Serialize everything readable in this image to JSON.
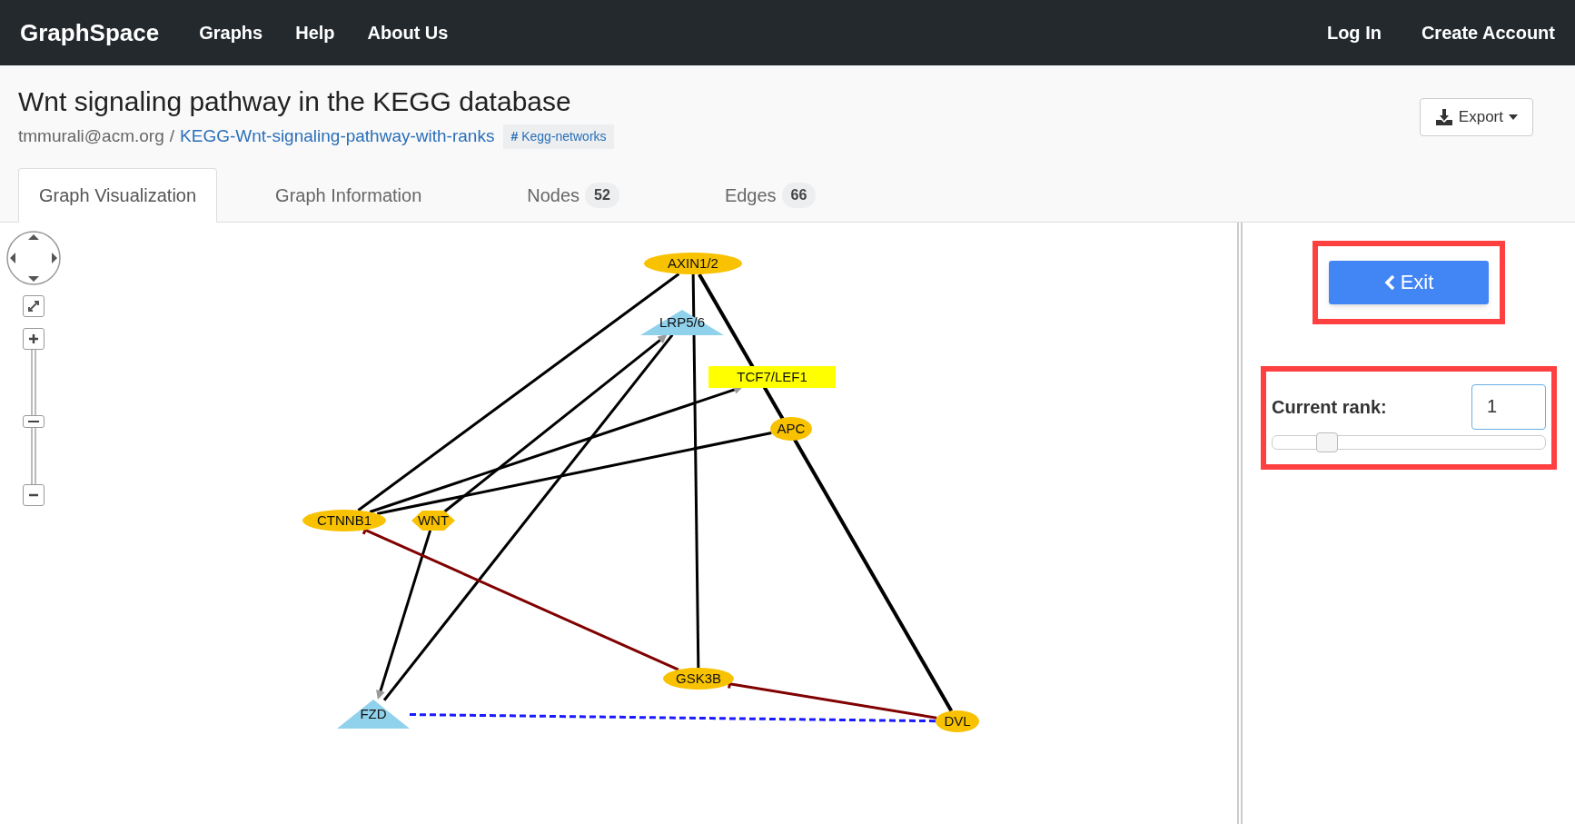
{
  "navbar": {
    "brand": "GraphSpace",
    "links": [
      "Graphs",
      "Help",
      "About Us"
    ],
    "account_links": [
      "Log In",
      "Create Account"
    ]
  },
  "header": {
    "title": "Wnt signaling pathway in the KEGG database",
    "owner": "tmmurali@acm.org",
    "separator": "/",
    "graph_name": "KEGG-Wnt-signaling-pathway-with-ranks",
    "tag": "Kegg-networks",
    "tag_symbol": "#",
    "export_button": "Export"
  },
  "tabs": [
    {
      "label": "Graph Visualization",
      "selected": true
    },
    {
      "label": "Graph Information",
      "selected": false
    },
    {
      "label": "Nodes",
      "count": "52",
      "selected": false
    },
    {
      "label": "Edges",
      "count": "66",
      "selected": false
    }
  ],
  "zoom_control": {
    "level": 0.46
  },
  "graph": {
    "nodes": [
      {
        "label": "AXIN1/2",
        "kind": "ellipse",
        "color": "#f8c200"
      },
      {
        "label": "LRP5/6",
        "kind": "triangle",
        "color": "#90d1ec"
      },
      {
        "label": "TCF7/LEF1",
        "kind": "rectangle",
        "color": "#ffff00"
      },
      {
        "label": "APC",
        "kind": "ellipse",
        "color": "#f8c200"
      },
      {
        "label": "CTNNB1",
        "kind": "ellipse",
        "color": "#f8c200"
      },
      {
        "label": "WNT",
        "kind": "hexagon",
        "color": "#f8c200"
      },
      {
        "label": "GSK3B",
        "kind": "ellipse",
        "color": "#f8c200"
      },
      {
        "label": "FZD",
        "kind": "triangle",
        "color": "#90d1ec"
      },
      {
        "label": "DVL",
        "kind": "ellipse",
        "color": "#f8c200"
      }
    ]
  },
  "side_panel": {
    "exit_button": "Exit",
    "rank_label": "Current rank:",
    "rank_value": "1",
    "rank_slider": {
      "level": 0.2
    }
  }
}
